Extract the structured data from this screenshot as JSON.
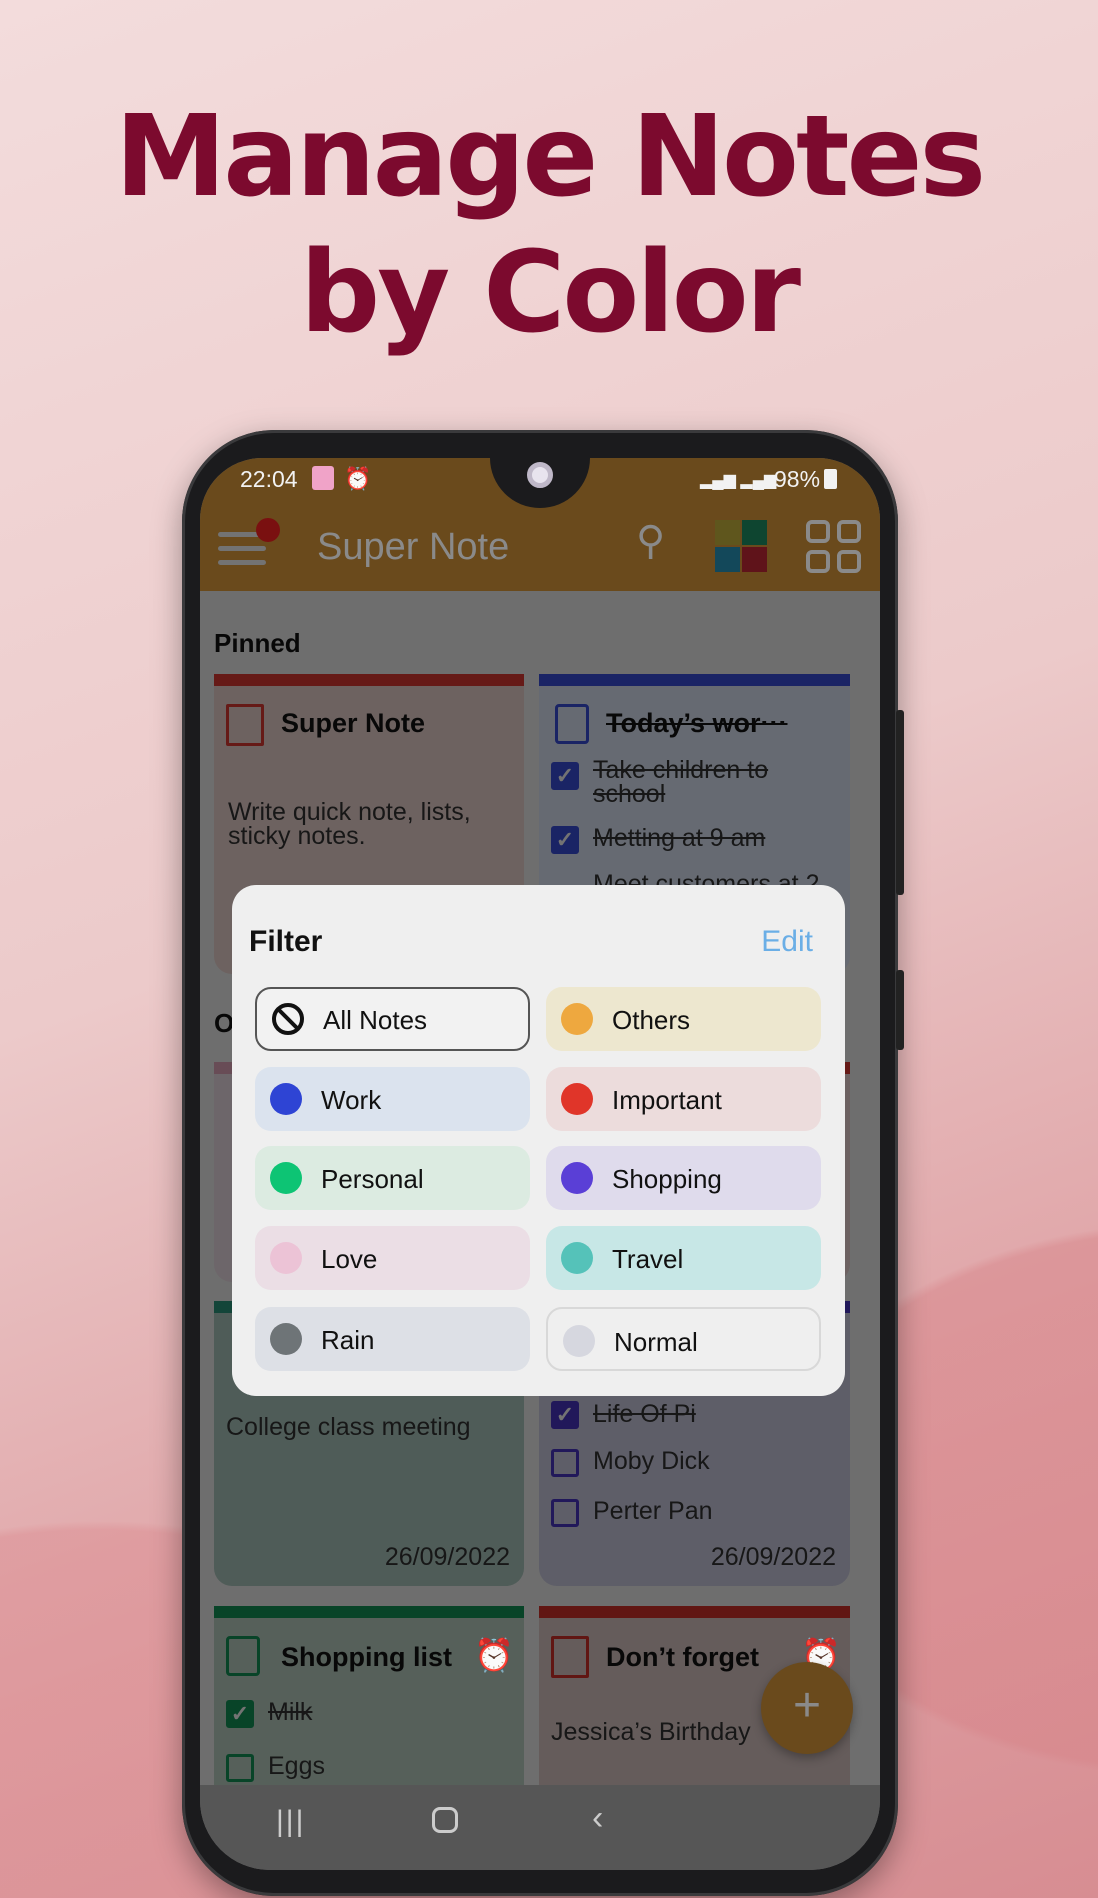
{
  "headline": {
    "line1": "Manage Notes",
    "line2": "by Color"
  },
  "status": {
    "time": "22:04",
    "battery": "98%"
  },
  "appbar": {
    "title": "Super Note",
    "accent": "#eca43e"
  },
  "pinned_label": "Pinned",
  "others_label_partial": "O",
  "cards": {
    "super_note": {
      "title": "Super Note",
      "body1": "Write quick note, lists,",
      "body2": "sticky notes."
    },
    "todays_work": {
      "title": "Today’s wor···",
      "items": [
        "Take children to",
        "school",
        "Metting at 9 am",
        "Meet customers at 2"
      ]
    },
    "college": {
      "body": "College class meeting",
      "date": "26/09/2022"
    },
    "books": {
      "items": [
        "Life Of Pi",
        "Moby Dick",
        "Perter Pan"
      ],
      "date": "26/09/2022"
    },
    "shopping": {
      "title": "Shopping list",
      "items": [
        "Milk",
        "Eggs"
      ]
    },
    "dont_forget": {
      "title": "Don’t forget",
      "body": "Jessica’s Birthday"
    }
  },
  "filter": {
    "title": "Filter",
    "edit": "Edit",
    "options": [
      {
        "label": "All Notes",
        "color": "",
        "selected": true
      },
      {
        "label": "Others",
        "color": "#eea83f",
        "bg": "#ede7cf"
      },
      {
        "label": "Work",
        "color": "#2e44d4",
        "bg": "#dbe3ee"
      },
      {
        "label": "Important",
        "color": "#e03529",
        "bg": "#ecdcdc"
      },
      {
        "label": "Personal",
        "color": "#0dc474",
        "bg": "#dcebe1"
      },
      {
        "label": "Shopping",
        "color": "#5a3fd6",
        "bg": "#dfdbec"
      },
      {
        "label": "Love",
        "color": "#ecc3d6",
        "bg": "#ebdee5"
      },
      {
        "label": "Travel",
        "color": "#55c2b9",
        "bg": "#c7e7e6"
      },
      {
        "label": "Rain",
        "color": "#6e7477",
        "bg": "#dde0e6"
      },
      {
        "label": "Normal",
        "color": "#d6d7df",
        "bg": "#efefef"
      }
    ]
  }
}
